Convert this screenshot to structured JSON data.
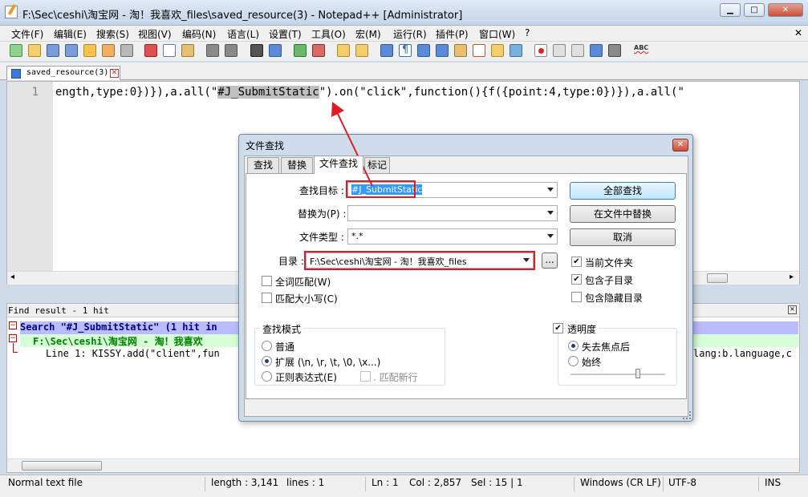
{
  "window": {
    "title": "F:\\Sec\\ceshi\\淘宝网 - 淘！我喜欢_files\\saved_resource(3) - Notepad++ [Administrator]"
  },
  "menu": [
    "文件(F)",
    "编辑(E)",
    "搜索(S)",
    "视图(V)",
    "编码(N)",
    "语言(L)",
    "设置(T)",
    "工具(O)",
    "宏(M)",
    "运行(R)",
    "插件(P)",
    "窗口(W)",
    "?"
  ],
  "tab": {
    "label": "saved_resource(3)"
  },
  "editor": {
    "line_number": "1",
    "code_before": "ength,type:0})}),a.all(\"",
    "code_selected": "#J_SubmitStatic",
    "code_after": "\").on(\"click\",function(){f({point:4,type:0})}),a.all(\""
  },
  "find_result": {
    "header": "Find result - 1 hit",
    "search_line": "Search \"#J_SubmitStatic\" (1 hit in",
    "file_line": "F:\\Sec\\ceshi\\淘宝网 - 淘！我喜欢",
    "hit_line": "Line 1: KISSY.add(\"client\",fun",
    "hit_line_tail": "lang:b.language,c"
  },
  "status": {
    "file_type": "Normal text file",
    "length": "length : 3,141",
    "lines": "lines : 1",
    "ln": "Ln : 1",
    "col": "Col : 2,857",
    "sel": "Sel : 15 | 1",
    "eol": "Windows (CR LF)",
    "encoding": "UTF-8",
    "mode": "INS"
  },
  "dialog": {
    "title": "文件查找",
    "tabs": [
      "查找",
      "替换",
      "文件查找",
      "标记"
    ],
    "find_label": "查找目标 :",
    "find_value": "#J_SubmitStatic",
    "replace_label": "替换为(P) :",
    "replace_value": "",
    "filter_label": "文件类型 :",
    "filter_value": "*.*",
    "dir_label": "目录 :",
    "dir_value": "F:\\Sec\\ceshi\\淘宝网 - 淘！我喜欢_files",
    "browse_label": "...",
    "find_all_btn": "全部查找",
    "replace_in_files_btn": "在文件中替换",
    "cancel_btn": "取消",
    "follow_current_doc": "当前文件夹",
    "in_subfolders": "包含子目录",
    "in_hidden": "包含隐藏目录",
    "whole_word": "全词匹配(W)",
    "match_case": "匹配大小写(C)",
    "search_mode_title": "查找模式",
    "mode_normal": "普通",
    "mode_extended": "扩展 (\\n, \\r, \\t, \\0, \\x...)",
    "mode_regex": "正则表达式(E)",
    "dot_newline": ". 匹配新行",
    "transparency": "透明度",
    "on_lose_focus": "失去焦点后",
    "always": "始终"
  },
  "colors": {
    "highlight_red": "#e01b24",
    "search_header_bg": "#bbbbff",
    "file_line_bg": "#d5ffd5"
  }
}
